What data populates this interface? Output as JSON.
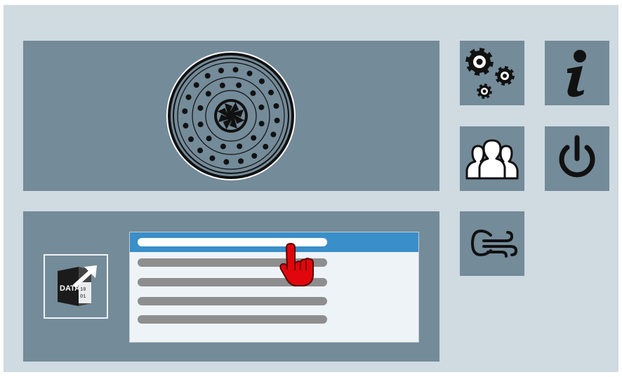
{
  "colors": {
    "background": "#cfdae1",
    "panel": "#748b99",
    "selection": "#3a8fc9",
    "list_bg": "#eef3f7",
    "list_item": "#8e8e8e",
    "cursor": "#e0060b"
  },
  "camera_panel": {
    "icon": "aperture-lens-icon"
  },
  "export_button": {
    "icon": "data-export-icon",
    "label_main": "DATA",
    "label_bits_top": "10",
    "label_bits_bottom": "01"
  },
  "list": {
    "selected_index": 0,
    "item_count": 5
  },
  "side_buttons": [
    {
      "name": "settings-button",
      "icon": "gears-icon"
    },
    {
      "name": "info-button",
      "icon": "info-icon"
    },
    {
      "name": "users-button",
      "icon": "users-icon"
    },
    {
      "name": "power-button",
      "icon": "power-icon"
    },
    {
      "name": "ventilation-button",
      "icon": "air-flow-icon"
    }
  ]
}
